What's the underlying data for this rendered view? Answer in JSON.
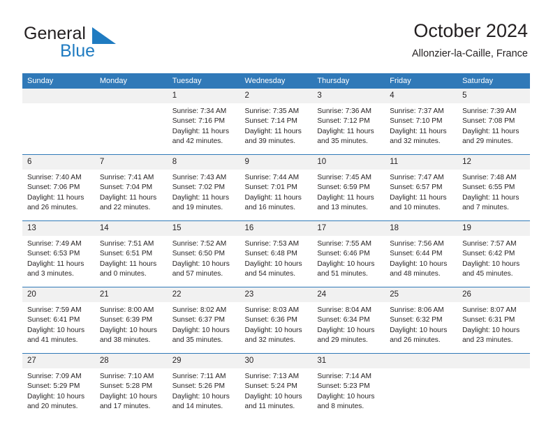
{
  "brand": {
    "name_part1": "General",
    "name_part2": "Blue",
    "mark_color": "#1f7bc1"
  },
  "header": {
    "title": "October 2024",
    "subtitle": "Allonzier-la-Caille, France"
  },
  "theme": {
    "header_bar": "#3079b8",
    "daynum_band": "#f1f1f1",
    "text": "#231f20"
  },
  "weekday_headers": [
    "Sunday",
    "Monday",
    "Tuesday",
    "Wednesday",
    "Thursday",
    "Friday",
    "Saturday"
  ],
  "weeks": [
    [
      {
        "day": "",
        "blank": true
      },
      {
        "day": "",
        "blank": true
      },
      {
        "day": "1",
        "sunrise": "Sunrise: 7:34 AM",
        "sunset": "Sunset: 7:16 PM",
        "daylight1": "Daylight: 11 hours",
        "daylight2": "and 42 minutes."
      },
      {
        "day": "2",
        "sunrise": "Sunrise: 7:35 AM",
        "sunset": "Sunset: 7:14 PM",
        "daylight1": "Daylight: 11 hours",
        "daylight2": "and 39 minutes."
      },
      {
        "day": "3",
        "sunrise": "Sunrise: 7:36 AM",
        "sunset": "Sunset: 7:12 PM",
        "daylight1": "Daylight: 11 hours",
        "daylight2": "and 35 minutes."
      },
      {
        "day": "4",
        "sunrise": "Sunrise: 7:37 AM",
        "sunset": "Sunset: 7:10 PM",
        "daylight1": "Daylight: 11 hours",
        "daylight2": "and 32 minutes."
      },
      {
        "day": "5",
        "sunrise": "Sunrise: 7:39 AM",
        "sunset": "Sunset: 7:08 PM",
        "daylight1": "Daylight: 11 hours",
        "daylight2": "and 29 minutes."
      }
    ],
    [
      {
        "day": "6",
        "sunrise": "Sunrise: 7:40 AM",
        "sunset": "Sunset: 7:06 PM",
        "daylight1": "Daylight: 11 hours",
        "daylight2": "and 26 minutes."
      },
      {
        "day": "7",
        "sunrise": "Sunrise: 7:41 AM",
        "sunset": "Sunset: 7:04 PM",
        "daylight1": "Daylight: 11 hours",
        "daylight2": "and 22 minutes."
      },
      {
        "day": "8",
        "sunrise": "Sunrise: 7:43 AM",
        "sunset": "Sunset: 7:02 PM",
        "daylight1": "Daylight: 11 hours",
        "daylight2": "and 19 minutes."
      },
      {
        "day": "9",
        "sunrise": "Sunrise: 7:44 AM",
        "sunset": "Sunset: 7:01 PM",
        "daylight1": "Daylight: 11 hours",
        "daylight2": "and 16 minutes."
      },
      {
        "day": "10",
        "sunrise": "Sunrise: 7:45 AM",
        "sunset": "Sunset: 6:59 PM",
        "daylight1": "Daylight: 11 hours",
        "daylight2": "and 13 minutes."
      },
      {
        "day": "11",
        "sunrise": "Sunrise: 7:47 AM",
        "sunset": "Sunset: 6:57 PM",
        "daylight1": "Daylight: 11 hours",
        "daylight2": "and 10 minutes."
      },
      {
        "day": "12",
        "sunrise": "Sunrise: 7:48 AM",
        "sunset": "Sunset: 6:55 PM",
        "daylight1": "Daylight: 11 hours",
        "daylight2": "and 7 minutes."
      }
    ],
    [
      {
        "day": "13",
        "sunrise": "Sunrise: 7:49 AM",
        "sunset": "Sunset: 6:53 PM",
        "daylight1": "Daylight: 11 hours",
        "daylight2": "and 3 minutes."
      },
      {
        "day": "14",
        "sunrise": "Sunrise: 7:51 AM",
        "sunset": "Sunset: 6:51 PM",
        "daylight1": "Daylight: 11 hours",
        "daylight2": "and 0 minutes."
      },
      {
        "day": "15",
        "sunrise": "Sunrise: 7:52 AM",
        "sunset": "Sunset: 6:50 PM",
        "daylight1": "Daylight: 10 hours",
        "daylight2": "and 57 minutes."
      },
      {
        "day": "16",
        "sunrise": "Sunrise: 7:53 AM",
        "sunset": "Sunset: 6:48 PM",
        "daylight1": "Daylight: 10 hours",
        "daylight2": "and 54 minutes."
      },
      {
        "day": "17",
        "sunrise": "Sunrise: 7:55 AM",
        "sunset": "Sunset: 6:46 PM",
        "daylight1": "Daylight: 10 hours",
        "daylight2": "and 51 minutes."
      },
      {
        "day": "18",
        "sunrise": "Sunrise: 7:56 AM",
        "sunset": "Sunset: 6:44 PM",
        "daylight1": "Daylight: 10 hours",
        "daylight2": "and 48 minutes."
      },
      {
        "day": "19",
        "sunrise": "Sunrise: 7:57 AM",
        "sunset": "Sunset: 6:42 PM",
        "daylight1": "Daylight: 10 hours",
        "daylight2": "and 45 minutes."
      }
    ],
    [
      {
        "day": "20",
        "sunrise": "Sunrise: 7:59 AM",
        "sunset": "Sunset: 6:41 PM",
        "daylight1": "Daylight: 10 hours",
        "daylight2": "and 41 minutes."
      },
      {
        "day": "21",
        "sunrise": "Sunrise: 8:00 AM",
        "sunset": "Sunset: 6:39 PM",
        "daylight1": "Daylight: 10 hours",
        "daylight2": "and 38 minutes."
      },
      {
        "day": "22",
        "sunrise": "Sunrise: 8:02 AM",
        "sunset": "Sunset: 6:37 PM",
        "daylight1": "Daylight: 10 hours",
        "daylight2": "and 35 minutes."
      },
      {
        "day": "23",
        "sunrise": "Sunrise: 8:03 AM",
        "sunset": "Sunset: 6:36 PM",
        "daylight1": "Daylight: 10 hours",
        "daylight2": "and 32 minutes."
      },
      {
        "day": "24",
        "sunrise": "Sunrise: 8:04 AM",
        "sunset": "Sunset: 6:34 PM",
        "daylight1": "Daylight: 10 hours",
        "daylight2": "and 29 minutes."
      },
      {
        "day": "25",
        "sunrise": "Sunrise: 8:06 AM",
        "sunset": "Sunset: 6:32 PM",
        "daylight1": "Daylight: 10 hours",
        "daylight2": "and 26 minutes."
      },
      {
        "day": "26",
        "sunrise": "Sunrise: 8:07 AM",
        "sunset": "Sunset: 6:31 PM",
        "daylight1": "Daylight: 10 hours",
        "daylight2": "and 23 minutes."
      }
    ],
    [
      {
        "day": "27",
        "sunrise": "Sunrise: 7:09 AM",
        "sunset": "Sunset: 5:29 PM",
        "daylight1": "Daylight: 10 hours",
        "daylight2": "and 20 minutes."
      },
      {
        "day": "28",
        "sunrise": "Sunrise: 7:10 AM",
        "sunset": "Sunset: 5:28 PM",
        "daylight1": "Daylight: 10 hours",
        "daylight2": "and 17 minutes."
      },
      {
        "day": "29",
        "sunrise": "Sunrise: 7:11 AM",
        "sunset": "Sunset: 5:26 PM",
        "daylight1": "Daylight: 10 hours",
        "daylight2": "and 14 minutes."
      },
      {
        "day": "30",
        "sunrise": "Sunrise: 7:13 AM",
        "sunset": "Sunset: 5:24 PM",
        "daylight1": "Daylight: 10 hours",
        "daylight2": "and 11 minutes."
      },
      {
        "day": "31",
        "sunrise": "Sunrise: 7:14 AM",
        "sunset": "Sunset: 5:23 PM",
        "daylight1": "Daylight: 10 hours",
        "daylight2": "and 8 minutes."
      },
      {
        "day": "",
        "blank": true
      },
      {
        "day": "",
        "blank": true
      }
    ]
  ]
}
